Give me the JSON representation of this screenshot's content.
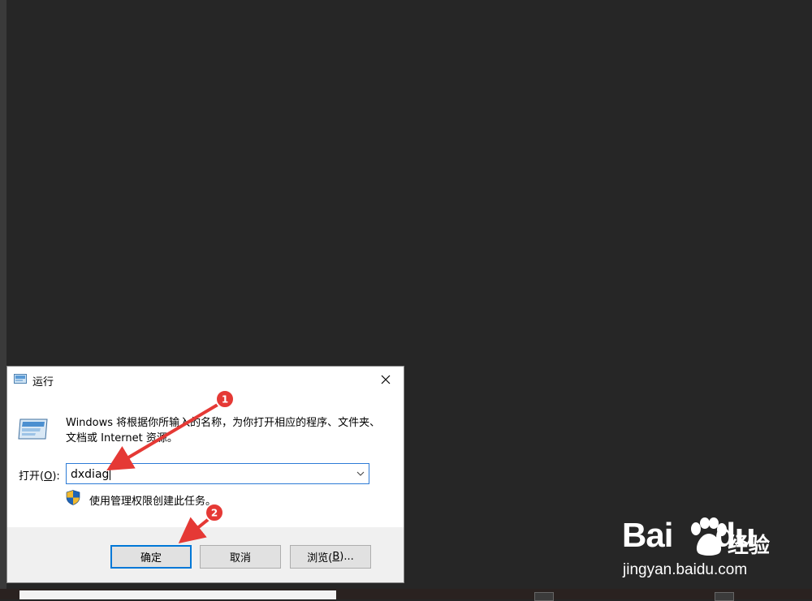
{
  "dialog": {
    "title": "运行",
    "description": "Windows 将根据你所输入的名称，为你打开相应的程序、文件夹、文档或 Internet 资源。",
    "open_label_prefix": "打开(",
    "open_label_key": "O",
    "open_label_suffix": "):",
    "input_value": "dxdiag",
    "admin_note": "使用管理权限创建此任务。",
    "buttons": {
      "ok": "确定",
      "cancel": "取消",
      "browse_prefix": "浏览(",
      "browse_key": "B",
      "browse_suffix": ")..."
    }
  },
  "annotations": {
    "step1": "1",
    "step2": "2"
  },
  "watermark": {
    "brand_left": "Bai",
    "brand_right": "du",
    "brand_cn": "经验",
    "url": "jingyan.baidu.com"
  },
  "colors": {
    "desktop": "#262626",
    "accent": "#0078d7",
    "annotation": "#e53935"
  },
  "icons": [
    "run-icon",
    "run-large-icon",
    "close-icon",
    "chevron-down-icon",
    "uac-shield-icon",
    "baidu-paw-icon"
  ]
}
